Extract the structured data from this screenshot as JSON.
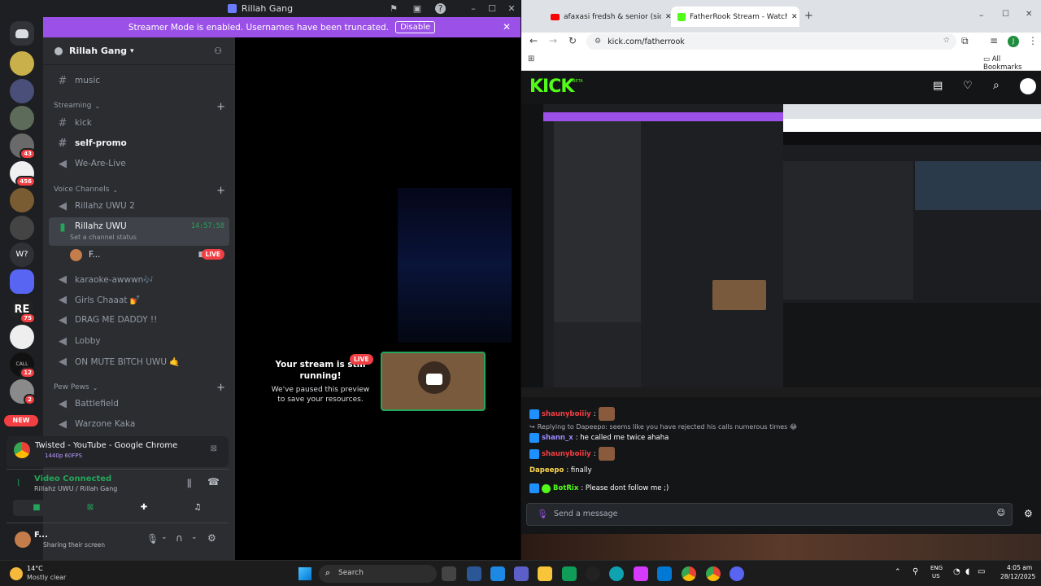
{
  "discord": {
    "window_title": "Rillah Gang",
    "banner_text": "Streamer Mode is enabled. Usernames have been truncated.",
    "banner_button": "Disable",
    "server_name": "Rillah Gang",
    "server_badges": [
      {
        "count": "43"
      },
      {
        "count": "456"
      },
      {
        "count": "75"
      },
      {
        "count": "12"
      },
      {
        "count": "2"
      }
    ],
    "new_label": "NEW",
    "channels": {
      "music": "music",
      "streaming_category": "Streaming",
      "kick": "kick",
      "self_promo": "self-promo",
      "we_are_live": "We-Are-Live",
      "voice_category": "Voice Channels",
      "rillahz_uwu_2": "Rillahz UWU 2",
      "rillahz_uwu": "Rillahz UWU",
      "rillahz_timer": "14:57:58",
      "set_status": "Set a channel status",
      "user_short": "F...",
      "live_badge": "LIVE",
      "karaoke": "karaoke-awwwn🎶",
      "girls_chaaat": "Girls Chaaat 💅",
      "drag_me_daddy": "DRAG ME DADDY !!",
      "lobby": "Lobby",
      "on_mute": "ON MUTE BITCH UWU 🤙",
      "pew_category": "Pew Pews",
      "battlefield": "Battlefield",
      "warzone": "Warzone Kaka"
    },
    "stage": {
      "paused_title": "Your stream is still running!",
      "paused_sub": "We've paused this preview to save your resources.",
      "live_badge": "LIVE"
    },
    "activity": {
      "title": "Twisted - YouTube - Google Chrome",
      "quality": "1440p 60FPS"
    },
    "voice": {
      "status": "Video Connected",
      "location": "Rillahz UWU / Rillah Gang"
    },
    "user": {
      "name": "F...",
      "status": "Sharing their screen"
    }
  },
  "chrome": {
    "tab1_title": "afaxasi fredsh & senior (sick - Y",
    "tab2_title": "FatherRook Stream - Watch Liv",
    "url": "kick.com/fatherrook",
    "all_bookmarks": "All Bookmarks",
    "kick_logo": "KICK",
    "kick_beta": "BETA"
  },
  "chat": {
    "messages": [
      {
        "user": "shaunyboiiiy",
        "text": ":",
        "color": "#f23f43",
        "emote": true,
        "badge": true
      },
      {
        "reply": "Replying to Dapeepo: seems like you have rejected his calls numerous times 😂"
      },
      {
        "user": "shann_x",
        "text": ": he called me twice ahaha",
        "color": "#9b8cff",
        "badge": true
      },
      {
        "user": "shaunyboiiiy",
        "text": ":",
        "color": "#f23f43",
        "emote": true,
        "badge": true
      },
      {
        "user": "Dapeepo",
        "text": ": finally",
        "color": "#ffd84d",
        "badge": false
      },
      {
        "user": "BotRix",
        "text": ": Please dont follow me ;)",
        "color": "#53fc18",
        "badge": true,
        "verified": true
      }
    ],
    "input_placeholder": "Send a message"
  },
  "taskbar": {
    "weather_temp": "14°C",
    "weather_desc": "Mostly clear",
    "search": "Search",
    "lang": "ENG",
    "region": "US",
    "time": "4:05 am",
    "date": "28/12/2025"
  }
}
